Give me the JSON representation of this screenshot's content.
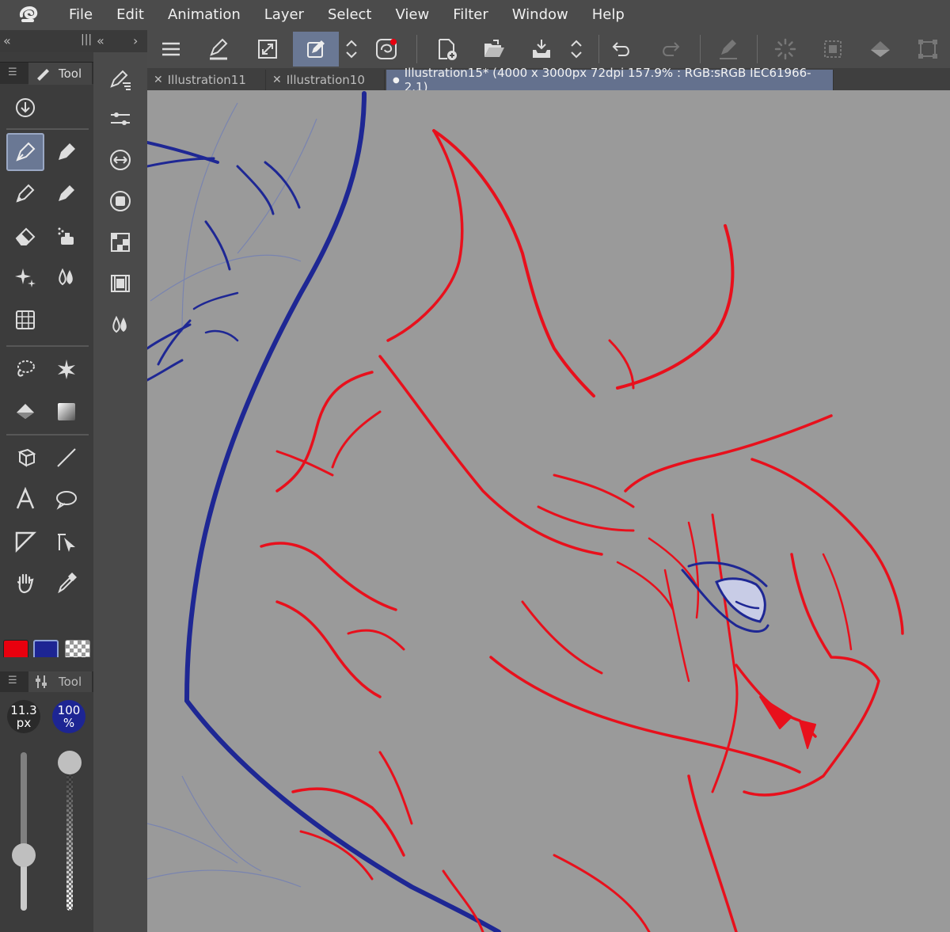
{
  "menu": [
    "File",
    "Edit",
    "Animation",
    "Layer",
    "Select",
    "View",
    "Filter",
    "Window",
    "Help"
  ],
  "tool_palette": {
    "tab_label": "Tool",
    "collapse_left": "«",
    "collapse_right": "«",
    "expand": "›",
    "tools": [
      "download-icon",
      "pen-icon",
      "marker-icon",
      "pencil-icon",
      "brush-icon",
      "eraser-icon",
      "airbrush-icon",
      "decoration-icon",
      "blend-icon",
      "operation-icon",
      "lasso-icon",
      "auto-select-icon",
      "fill-icon",
      "gradient-icon",
      "3d-box-icon",
      "line-icon",
      "text-icon",
      "balloon-icon",
      "frame-icon",
      "ruler-icon",
      "hand-icon",
      "eyedropper-icon"
    ],
    "active_tool": "pen-icon"
  },
  "colors": {
    "main": "#e8000e",
    "sub": "#1d2593",
    "transparent": "checker"
  },
  "tool_property": {
    "tab_label": "Tool",
    "brush_size": "11.3",
    "brush_size_unit": "px",
    "opacity": "100",
    "opacity_unit": "%",
    "brush_size_level": 0.35,
    "opacity_level": 1.0
  },
  "command_bar": [
    "menu-icon",
    "brush-shape-icon",
    "fit-icon",
    "edit-layer-icon",
    "updown-icon",
    "clip-studio-icon",
    "new-icon",
    "open-icon",
    "save-icon",
    "updown-icon",
    "undo-icon",
    "redo-icon",
    "pen-pressure-icon",
    "deselect-icon",
    "select-all-icon",
    "fill-icon",
    "transform-icon"
  ],
  "tabs": [
    {
      "label": "Illustration11",
      "active": false
    },
    {
      "label": "Illustration10",
      "active": false
    },
    {
      "label": "Illustration15* (4000 x 3000px 72dpi 157.9% : RGB:sRGB IEC61966-2.1)",
      "active": true
    }
  ],
  "canvas_colors": {
    "background": "#9a9a9a",
    "red_line": "#e8101c",
    "blue_line": "#1e2794"
  }
}
